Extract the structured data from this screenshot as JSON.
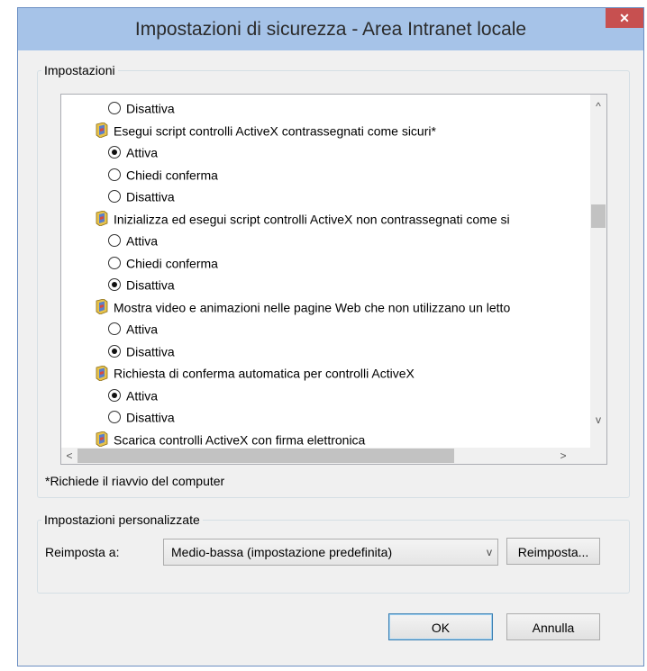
{
  "window": {
    "title": "Impostazioni di sicurezza - Area Intranet locale",
    "close_glyph": "✕"
  },
  "settings_group": {
    "legend": "Impostazioni",
    "rows": [
      {
        "kind": "radio",
        "label": "Disattiva",
        "checked": false
      },
      {
        "kind": "setting",
        "label": "Esegui script controlli ActiveX contrassegnati come sicuri*",
        "icon": "setting-shield-icon"
      },
      {
        "kind": "radio",
        "label": "Attiva",
        "checked": true
      },
      {
        "kind": "radio",
        "label": "Chiedi conferma",
        "checked": false
      },
      {
        "kind": "radio",
        "label": "Disattiva",
        "checked": false
      },
      {
        "kind": "setting",
        "label": "Inizializza ed esegui script controlli ActiveX non contrassegnati come si",
        "icon": "setting-shield-icon"
      },
      {
        "kind": "radio",
        "label": "Attiva",
        "checked": false
      },
      {
        "kind": "radio",
        "label": "Chiedi conferma",
        "checked": false
      },
      {
        "kind": "radio",
        "label": "Disattiva",
        "checked": true
      },
      {
        "kind": "setting",
        "label": "Mostra video e animazioni nelle pagine Web che non utilizzano un letto",
        "icon": "setting-shield-icon"
      },
      {
        "kind": "radio",
        "label": "Attiva",
        "checked": false
      },
      {
        "kind": "radio",
        "label": "Disattiva",
        "checked": true
      },
      {
        "kind": "setting",
        "label": "Richiesta di conferma automatica per controlli ActiveX",
        "icon": "setting-shield-icon"
      },
      {
        "kind": "radio",
        "label": "Attiva",
        "checked": true
      },
      {
        "kind": "radio",
        "label": "Disattiva",
        "checked": false
      },
      {
        "kind": "setting",
        "label": "Scarica controlli ActiveX con firma elettronica",
        "icon": "setting-shield-icon"
      }
    ],
    "footnote": "*Richiede il riavvio del computer",
    "scroll_up": "^",
    "scroll_down": "v",
    "scroll_left": "<",
    "scroll_right": ">"
  },
  "custom_group": {
    "legend": "Impostazioni personalizzate",
    "reset_label": "Reimposta a:",
    "reset_select_value": "Medio-bassa (impostazione predefinita)",
    "select_chevron": "v",
    "reset_button": "Reimposta..."
  },
  "footer": {
    "ok_button": "OK",
    "cancel_button": "Annulla"
  },
  "colors": {
    "titlebar": "#a6c3e8",
    "close": "#c75050",
    "dialog_bg": "#f0f0f0"
  }
}
